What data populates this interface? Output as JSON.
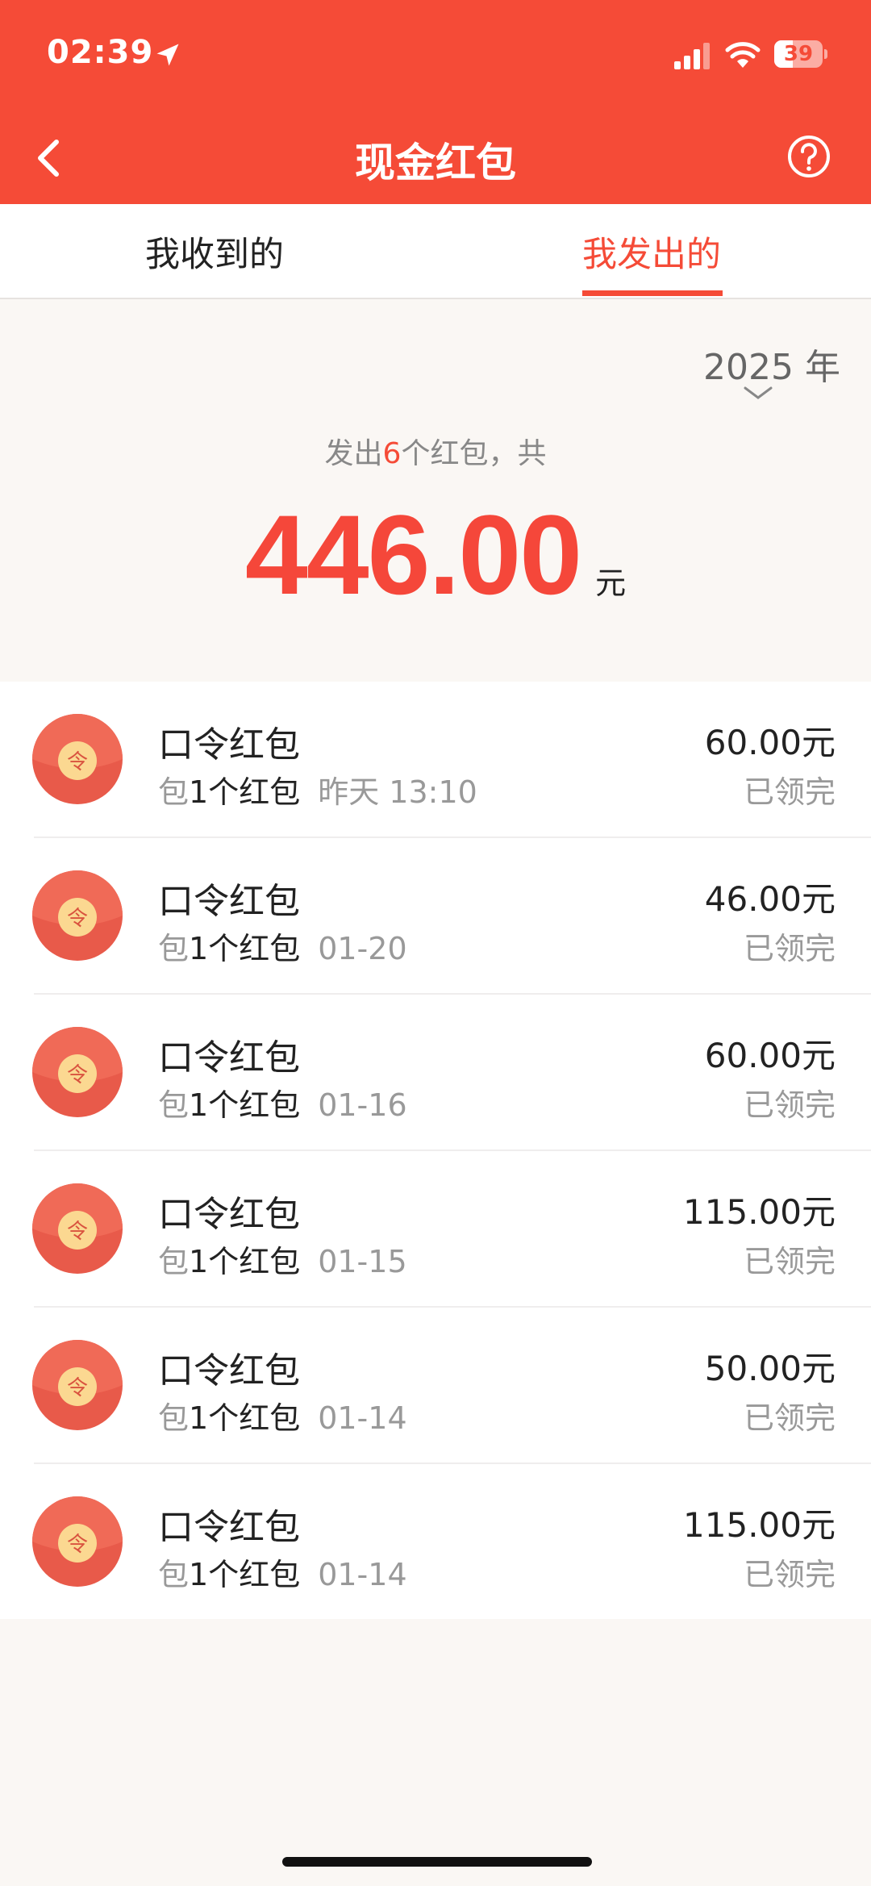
{
  "status_bar": {
    "time": "02:39",
    "battery": "39",
    "battery_level": 0.39,
    "icons": [
      "location-arrow-icon",
      "cellular-signal-icon",
      "wifi-icon",
      "battery-icon"
    ]
  },
  "nav": {
    "title": "现金红包",
    "back_icon": "chevron-left-icon",
    "help_icon": "question-circle-icon"
  },
  "tabs": [
    {
      "label": "我收到的",
      "active": false
    },
    {
      "label": "我发出的",
      "active": true
    }
  ],
  "summary": {
    "year": "2025 年",
    "prefix": "发出",
    "count": "6",
    "suffix": "个红包，共",
    "total": "446.00",
    "unit": "元"
  },
  "items": [
    {
      "title": "口令红包",
      "sub_prefix": "包",
      "sub_main": "1个红包",
      "date": "昨天 13:10",
      "amount": "60.00元",
      "status": "已领完"
    },
    {
      "title": "口令红包",
      "sub_prefix": "包",
      "sub_main": "1个红包",
      "date": "01-20",
      "amount": "46.00元",
      "status": "已领完"
    },
    {
      "title": "口令红包",
      "sub_prefix": "包",
      "sub_main": "1个红包",
      "date": "01-16",
      "amount": "60.00元",
      "status": "已领完"
    },
    {
      "title": "口令红包",
      "sub_prefix": "包",
      "sub_main": "1个红包",
      "date": "01-15",
      "amount": "115.00元",
      "status": "已领完"
    },
    {
      "title": "口令红包",
      "sub_prefix": "包",
      "sub_main": "1个红包",
      "date": "01-14",
      "amount": "50.00元",
      "status": "已领完"
    },
    {
      "title": "口令红包",
      "sub_prefix": "包",
      "sub_main": "1个红包",
      "date": "01-14",
      "amount": "115.00元",
      "status": "已领完"
    }
  ],
  "icon_glyph": "令",
  "colors": {
    "accent": "#f54b37",
    "page_background": "#faf7f4",
    "envelope_red": "#e85a4a",
    "envelope_coin": "#fbd891"
  }
}
